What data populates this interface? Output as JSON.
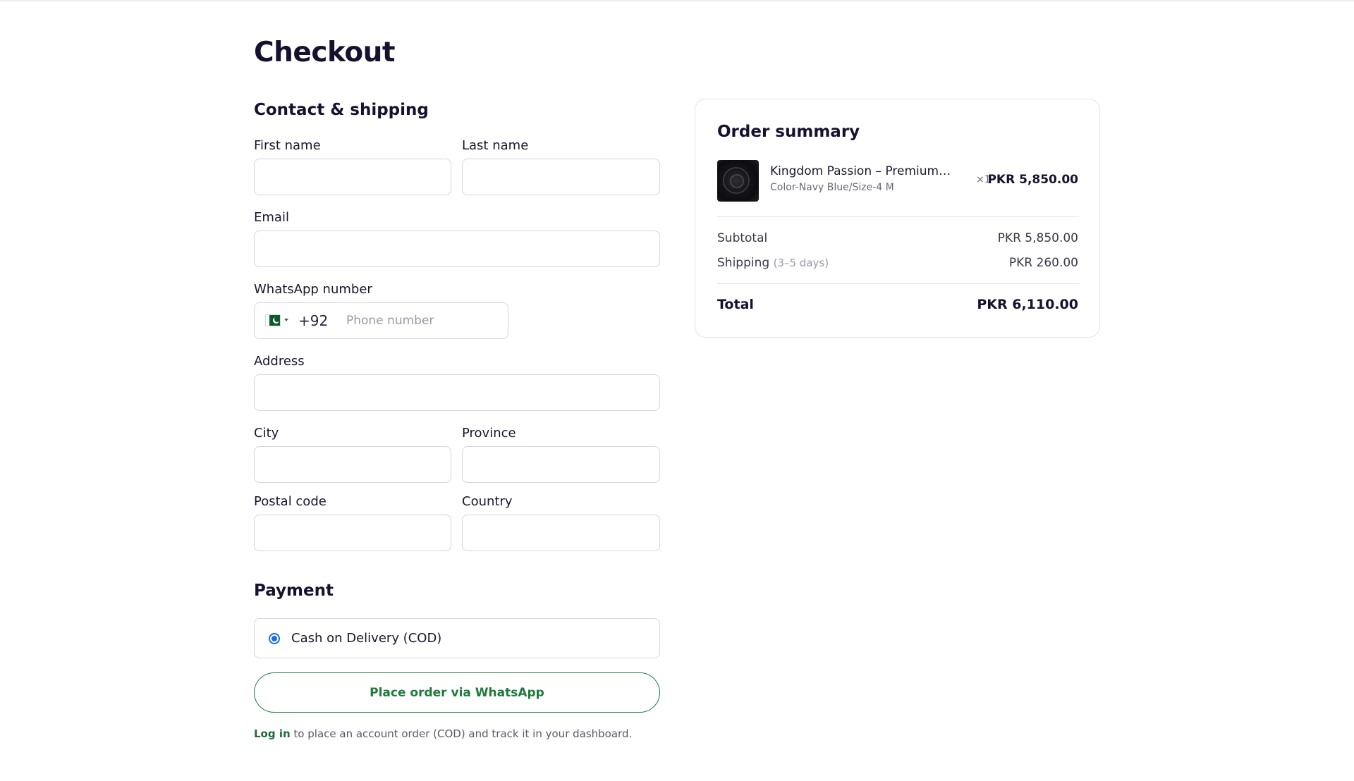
{
  "page": {
    "title": "Checkout"
  },
  "contact": {
    "section_title": "Contact & shipping",
    "first_name_label": "First name",
    "first_name_value": "",
    "last_name_label": "Last name",
    "last_name_value": "",
    "email_label": "Email",
    "email_value": "",
    "whatsapp_label": "WhatsApp number",
    "dial_code": "+92",
    "country_flag": "pakistan-flag-icon",
    "phone_placeholder": "Phone number",
    "phone_value": "",
    "address_label": "Address",
    "address_value": "",
    "city_label": "City",
    "city_value": "",
    "province_label": "Province",
    "province_value": "",
    "postal_label": "Postal code",
    "postal_value": "",
    "country_label": "Country",
    "country_value": ""
  },
  "payment": {
    "section_title": "Payment",
    "option_label": "Cash on Delivery (COD)",
    "option_selected": true,
    "submit_label": "Place order via WhatsApp",
    "login_link": "Log in",
    "login_note": " to place an account order (COD) and track it in your dashboard."
  },
  "summary": {
    "title": "Order summary",
    "items": [
      {
        "name": "Kingdom Passion – Premium…",
        "variant": "Color-Navy Blue/Size-4 M",
        "qty": "×1",
        "price": "PKR 5,850.00"
      }
    ],
    "subtotal_label": "Subtotal",
    "subtotal_value": "PKR 5,850.00",
    "shipping_label": "Shipping",
    "shipping_hint": "(3–5 days)",
    "shipping_value": "PKR 260.00",
    "total_label": "Total",
    "total_value": "PKR 6,110.00"
  },
  "colors": {
    "heading": "#16112e",
    "whatsapp_green": "#1f7a3b",
    "radio_blue": "#1a6ee0",
    "border": "#d6d6de"
  }
}
